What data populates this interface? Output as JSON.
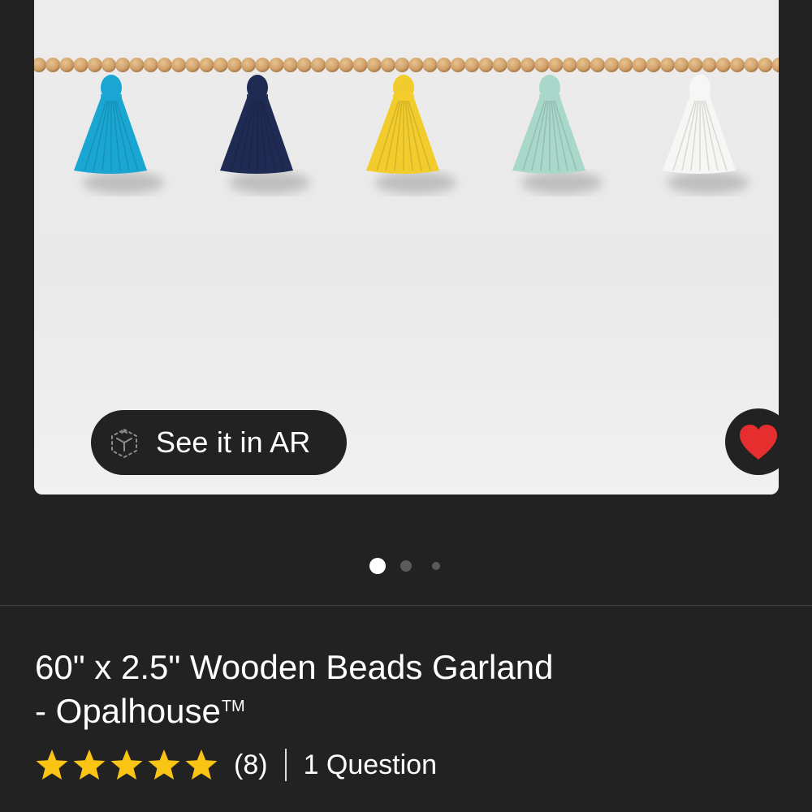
{
  "product": {
    "title_line1": "60\" x 2.5\" Wooden Beads Garland",
    "title_line2": "- Opalhouse",
    "trademark": "TM"
  },
  "image": {
    "ar_label": "See it in AR",
    "tassel_colors": [
      "#1aa6d2",
      "#1f2b52",
      "#f2cc2c",
      "#a9d8cb",
      "#f6f6f4"
    ],
    "bead_color": "#cfa06a",
    "favorite_icon": "heart-icon",
    "favorite_color": "#e62e2e"
  },
  "carousel": {
    "total_dots": 3,
    "active_index": 0
  },
  "rating": {
    "stars_value": 5,
    "stars_max": 5,
    "star_color": "#f9c413",
    "review_count": "(8)",
    "questions_label": "1 Question"
  }
}
